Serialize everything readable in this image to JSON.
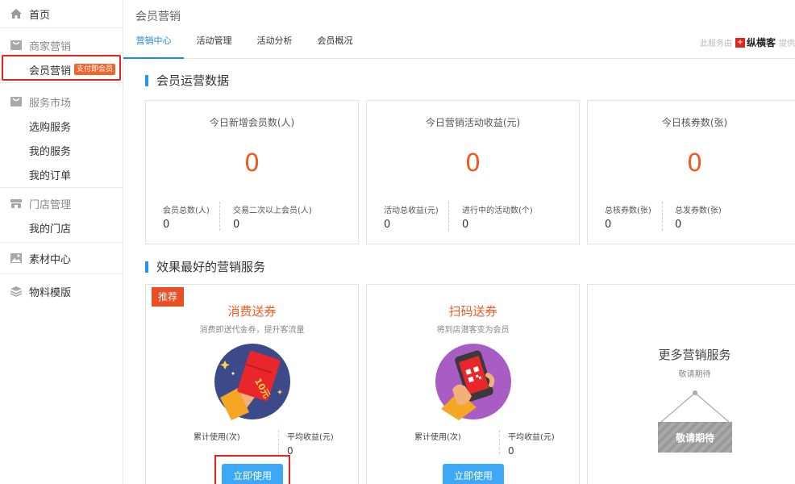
{
  "sidebar": {
    "home": "首页",
    "merchant_marketing": "商家营销",
    "member_marketing": "会员营销",
    "member_badge": "支付即会员",
    "service_market": "服务市场",
    "buy_service": "选购服务",
    "my_service": "我的服务",
    "my_orders": "我的订单",
    "store_mgmt": "门店管理",
    "my_store": "我的门店",
    "material_center": "素材中心",
    "material_template": "物料模版"
  },
  "header": {
    "title": "会员营销",
    "tabs": [
      "营销中心",
      "活动管理",
      "活动分析",
      "会员概况"
    ],
    "provider_prefix": "此服务由",
    "provider_brand": "纵横客",
    "provider_suffix": "提供"
  },
  "sections": {
    "ops_data": "会员运营数据",
    "best_services": "效果最好的营销服务"
  },
  "stats": [
    {
      "title": "今日新增会员数(人)",
      "value": "0",
      "sub1_label": "会员总数(人)",
      "sub1_value": "0",
      "sub2_label": "交易二次以上会员(人)",
      "sub2_value": "0"
    },
    {
      "title": "今日营销活动收益(元)",
      "value": "0",
      "sub1_label": "活动总收益(元)",
      "sub1_value": "0",
      "sub2_label": "进行中的活动数(个)",
      "sub2_value": "0"
    },
    {
      "title": "今日核券数(张)",
      "value": "0",
      "sub1_label": "总核券数(张)",
      "sub1_value": "0",
      "sub2_label": "总发券数(张)",
      "sub2_value": "0"
    }
  ],
  "services": [
    {
      "badge": "推荐",
      "title": "消费送券",
      "desc": "消费即送代金券，提升客流量",
      "coupon_text": "10元",
      "stat1_label": "累计使用(次)",
      "stat1_value": "",
      "stat2_label": "平均收益(元)",
      "stat2_value": "0",
      "button": "立即使用"
    },
    {
      "title": "扫码送券",
      "desc": "将到店潜客变为会员",
      "stat1_label": "累计使用(次)",
      "stat1_value": "",
      "stat2_label": "平均收益(元)",
      "stat2_value": "0",
      "button": "立即使用"
    }
  ],
  "more": {
    "title": "更多营销服务",
    "desc": "敬请期待",
    "sign_text": "敬请期待"
  },
  "colors": {
    "accent": "#1e88e5",
    "orange": "#f05a22",
    "highlight": "#e0261b",
    "button": "#3da8f5"
  }
}
